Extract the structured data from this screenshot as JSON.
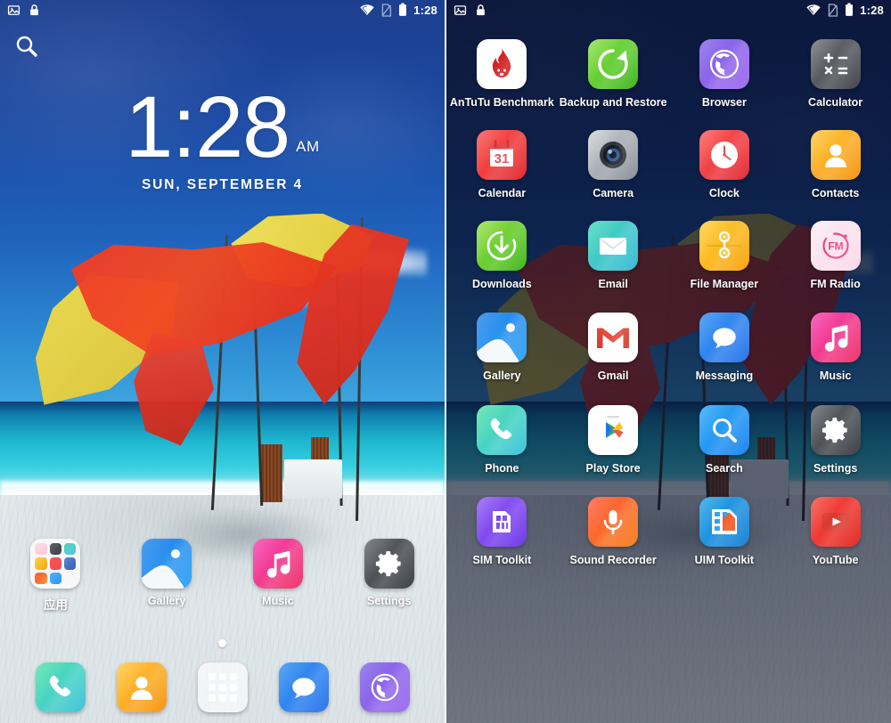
{
  "device": {
    "status_bar": {
      "icons_left": [
        "screenshot-icon",
        "lock-icon"
      ],
      "icons_right": [
        "wifi-icon",
        "sim-off-icon",
        "battery-icon"
      ],
      "time": "1:28"
    }
  },
  "left_screen": {
    "name": "home-screen",
    "search_icon": "search-icon",
    "clock": {
      "time": "1:28",
      "ampm": "AM",
      "date": "SUN, SEPTEMBER 4"
    },
    "home_icons": [
      {
        "label": "应用",
        "icon": "folder-icon",
        "is_folder": true
      },
      {
        "label": "Gallery",
        "icon": "gallery-icon"
      },
      {
        "label": "Music",
        "icon": "music-icon"
      },
      {
        "label": "Settings",
        "icon": "settings-icon"
      }
    ],
    "page_indicator": {
      "pages": 1,
      "current": 1
    },
    "dock": [
      {
        "label": "Phone",
        "icon": "phone-icon"
      },
      {
        "label": "Contacts",
        "icon": "contacts-icon"
      },
      {
        "label": "App Drawer",
        "icon": "app-drawer-icon"
      },
      {
        "label": "Messaging",
        "icon": "messaging-icon"
      },
      {
        "label": "Browser",
        "icon": "browser-icon"
      }
    ]
  },
  "right_screen": {
    "name": "app-drawer",
    "apps": [
      {
        "label": "AnTuTu Benchmark",
        "icon": "antutu-icon"
      },
      {
        "label": "Backup and Restore",
        "icon": "backup-restore-icon"
      },
      {
        "label": "Browser",
        "icon": "browser-icon"
      },
      {
        "label": "Calculator",
        "icon": "calculator-icon"
      },
      {
        "label": "Calendar",
        "icon": "calendar-icon"
      },
      {
        "label": "Camera",
        "icon": "camera-icon"
      },
      {
        "label": "Clock",
        "icon": "clock-icon"
      },
      {
        "label": "Contacts",
        "icon": "contacts-icon"
      },
      {
        "label": "Downloads",
        "icon": "downloads-icon"
      },
      {
        "label": "Email",
        "icon": "email-icon"
      },
      {
        "label": "File Manager",
        "icon": "file-manager-icon"
      },
      {
        "label": "FM Radio",
        "icon": "fm-radio-icon"
      },
      {
        "label": "Gallery",
        "icon": "gallery-icon"
      },
      {
        "label": "Gmail",
        "icon": "gmail-icon"
      },
      {
        "label": "Messaging",
        "icon": "messaging-icon"
      },
      {
        "label": "Music",
        "icon": "music-icon"
      },
      {
        "label": "Phone",
        "icon": "phone-icon"
      },
      {
        "label": "Play Store",
        "icon": "play-store-icon"
      },
      {
        "label": "Search",
        "icon": "search-icon"
      },
      {
        "label": "Settings",
        "icon": "settings-icon"
      },
      {
        "label": "SIM Toolkit",
        "icon": "sim-toolkit-icon"
      },
      {
        "label": "Sound Recorder",
        "icon": "sound-recorder-icon"
      },
      {
        "label": "UIM Toolkit",
        "icon": "uim-toolkit-icon"
      },
      {
        "label": "YouTube",
        "icon": "youtube-icon"
      }
    ]
  },
  "colors": {
    "sky_blue": "#1f62bd",
    "sea_teal": "#1db7cf",
    "sand": "#e2e9ec",
    "fabric_red": "#e8341f",
    "fabric_yellow": "#efd23a",
    "drawer_scrim": "#060e22",
    "status_text": "#ffffff"
  }
}
